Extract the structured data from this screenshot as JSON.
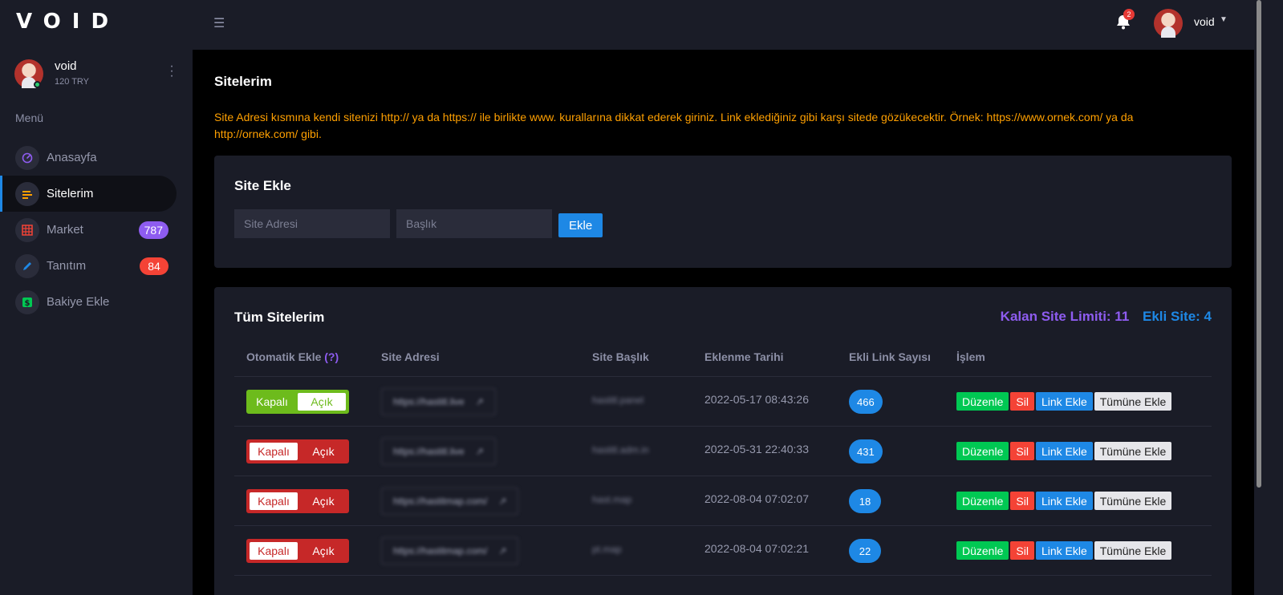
{
  "app": {
    "logo": "VOID"
  },
  "colors": {
    "sidebar_bg": "#1a1c27",
    "accent_blue": "#1e88e5",
    "accent_purple": "#8e5cf0",
    "warning_orange": "#ffa000"
  },
  "sidebar": {
    "user_name": "void",
    "balance": "120 TRY",
    "menu_heading": "Menü",
    "items": [
      {
        "label": "Anasayfa",
        "icon": "speedometer-icon",
        "badge": ""
      },
      {
        "label": "Sitelerim",
        "icon": "list-icon",
        "badge": "",
        "active": true
      },
      {
        "label": "Market",
        "icon": "grid-icon",
        "badge": "787",
        "badge_color": "#8e5cf0"
      },
      {
        "label": "Tanıtım",
        "icon": "pencil-icon",
        "badge": "84",
        "badge_color": "#f44336"
      },
      {
        "label": "Bakiye Ekle",
        "icon": "dollar-icon",
        "badge": ""
      }
    ]
  },
  "header": {
    "notification_count": "2",
    "user_name": "void"
  },
  "page": {
    "title": "Sitelerim",
    "info": "Site Adresi kısmına kendi sitenizi http:// ya da https:// ile birlikte www. kurallarına dikkat ederek giriniz. Link eklediğiniz gibi karşı sitede gözükecektir. Örnek: https://www.ornek.com/ ya da http://ornek.com/ gibi."
  },
  "add_form": {
    "title": "Site Ekle",
    "url_placeholder": "Site Adresi",
    "title_placeholder": "Başlık",
    "submit_label": "Ekle"
  },
  "sites": {
    "title": "Tüm Sitelerim",
    "remaining_limit": "Kalan Site Limiti: 11",
    "added_count": "Ekli Site: 4",
    "columns": {
      "auto_add": "Otomatik Ekle",
      "auto_add_hint": "(?)",
      "url": "Site Adresi",
      "site_title": "Site Başlık",
      "date": "Eklenme Tarihi",
      "link_count": "Ekli Link Sayısı",
      "action": "İşlem"
    },
    "toggle_labels": {
      "off": "Kapalı",
      "on": "Açık"
    },
    "action_labels": {
      "edit": "Düzenle",
      "delete": "Sil",
      "add_link": "Link Ekle",
      "add_all": "Tümüne Ekle"
    },
    "rows": [
      {
        "auto_on": true,
        "url": "https://hastitl.live",
        "title": "hastitl.panel",
        "date": "2022-05-17 08:43:26",
        "links": "466"
      },
      {
        "auto_on": false,
        "url": "https://hastitl.live",
        "title": "hastitl.adm.in",
        "date": "2022-05-31 22:40:33",
        "links": "431"
      },
      {
        "auto_on": false,
        "url": "https://hastitmap.com/",
        "title": "hast.map",
        "date": "2022-08-04 07:02:07",
        "links": "18"
      },
      {
        "auto_on": false,
        "url": "https://hastitmap.com/",
        "title": "pt.map",
        "date": "2022-08-04 07:02:21",
        "links": "22"
      }
    ]
  }
}
